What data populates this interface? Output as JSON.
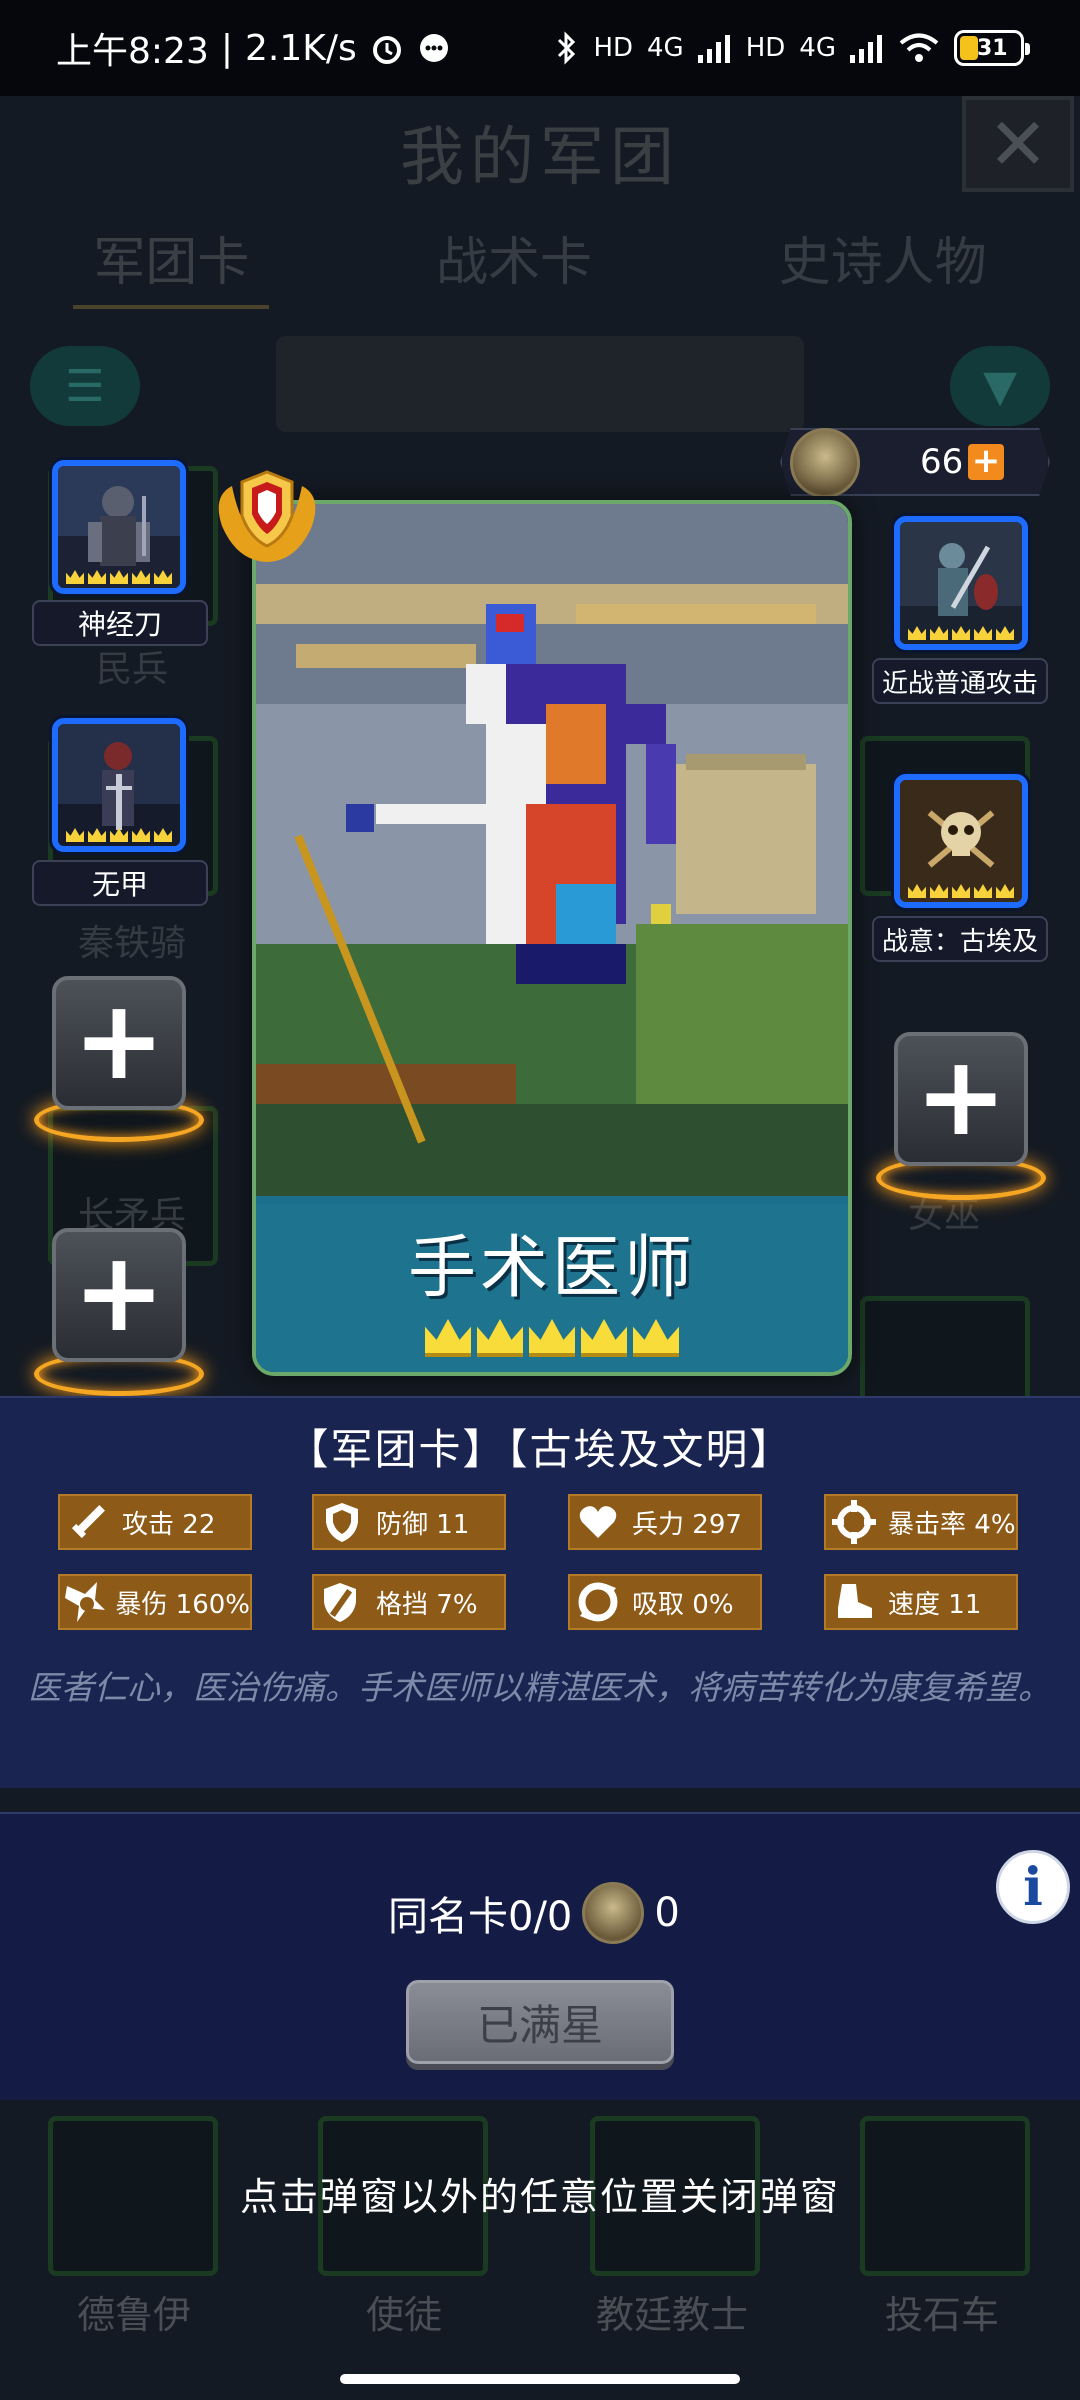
{
  "status_bar": {
    "time": "上午8:23",
    "net_speed": "2.1K/s",
    "net_label_hd1": "HD",
    "net_label_4g1": "4G",
    "net_label_hd2": "HD",
    "net_label_4g2": "4G",
    "battery": "31"
  },
  "background": {
    "title": "我的军团",
    "tabs": [
      "军团卡",
      "战术卡",
      "史诗人物"
    ],
    "ghost_labels": [
      "民兵",
      "秦铁骑",
      "长矛兵",
      "女巫",
      "德鲁伊",
      "使徒",
      "教廷教士",
      "投石车"
    ]
  },
  "left_slots": [
    {
      "label": "神经刀",
      "crowns": 5
    },
    {
      "label": "无甲",
      "crowns": 5
    }
  ],
  "right_slots": [
    {
      "label": "近战普通攻击",
      "crowns": 5
    },
    {
      "label": "战意：古埃及",
      "crowns": 5
    }
  ],
  "currency": {
    "amount": "66",
    "plus": "+"
  },
  "main_card": {
    "name": "手术医师",
    "crowns": 5
  },
  "detail": {
    "tags": "【军团卡】【古埃及文明】",
    "stats": [
      {
        "icon": "sword-icon",
        "label": "攻击",
        "value": "22"
      },
      {
        "icon": "shield-icon",
        "label": "防御",
        "value": "11"
      },
      {
        "icon": "heart-icon",
        "label": "兵力",
        "value": "297"
      },
      {
        "icon": "crosshair-icon",
        "label": "暴击率",
        "value": "4%"
      },
      {
        "icon": "burst-icon",
        "label": "暴伤",
        "value": "160%"
      },
      {
        "icon": "block-icon",
        "label": "格挡",
        "value": "7%"
      },
      {
        "icon": "lifesteal-icon",
        "label": "吸取",
        "value": "0%"
      },
      {
        "icon": "boot-icon",
        "label": "速度",
        "value": "11"
      }
    ],
    "description": "医者仁心，医治伤痛。手术医师以精湛医术，将病苦转化为康复希望。"
  },
  "duplicate": {
    "label": "同名卡0/0",
    "emblem_count": "0",
    "button": "已满星",
    "info": "i"
  },
  "close_hint": "点击弹窗以外的任意位置关闭弹窗",
  "icons": {
    "close": "✕",
    "plus": "+"
  }
}
